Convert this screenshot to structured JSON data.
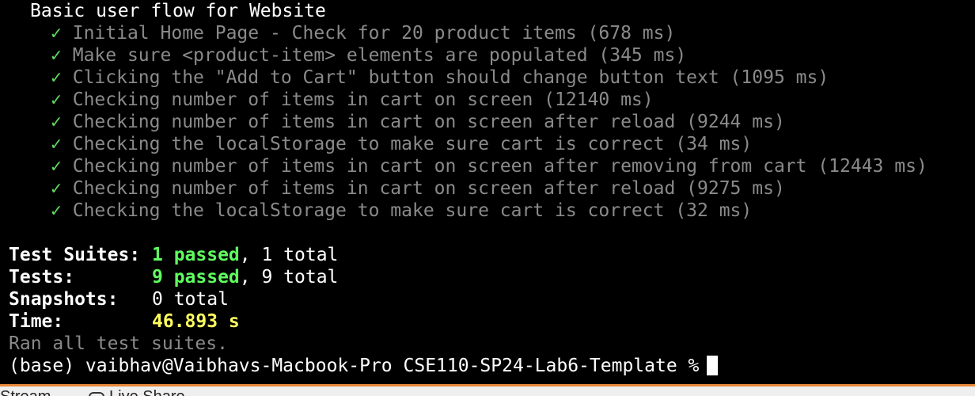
{
  "terminal": {
    "suite_title": "Basic user flow for Website",
    "tests": [
      {
        "check": "✓",
        "text": "Initial Home Page - Check for 20 product items (678 ms)"
      },
      {
        "check": "✓",
        "text": "Make sure <product-item> elements are populated (345 ms)"
      },
      {
        "check": "✓",
        "text": "Clicking the \"Add to Cart\" button should change button text (1095 ms)"
      },
      {
        "check": "✓",
        "text": "Checking number of items in cart on screen (12140 ms)"
      },
      {
        "check": "✓",
        "text": "Checking number of items in cart on screen after reload (9244 ms)"
      },
      {
        "check": "✓",
        "text": "Checking the localStorage to make sure cart is correct (34 ms)"
      },
      {
        "check": "✓",
        "text": "Checking number of items in cart on screen after removing from cart (12443 ms)"
      },
      {
        "check": "✓",
        "text": "Checking number of items in cart on screen after reload (9275 ms)"
      },
      {
        "check": "✓",
        "text": "Checking the localStorage to make sure cart is correct (32 ms)"
      }
    ],
    "summary": {
      "suites_label": "Test Suites:",
      "suites_passed": "1 passed",
      "suites_rest": ", 1 total",
      "tests_label": "Tests:",
      "tests_passed": "9 passed",
      "tests_rest": ", 9 total",
      "snapshots_label": "Snapshots:",
      "snapshots_value": "0 total",
      "time_label": "Time:",
      "time_value": "46.893 s"
    },
    "ran_all": "Ran all test suites.",
    "prompt": "(base) vaibhav@Vaibhavs-Macbook-Pro CSE110-SP24-Lab6-Template %"
  },
  "statusbar": {
    "stream_label": "Stream",
    "live_share_label": "Live Share",
    "live_share_icon": "live-share-icon"
  },
  "colors": {
    "background": "#000000",
    "pass_green": "#5fff5f",
    "check_green": "#5fd75f",
    "muted_gray": "#8a8a8a",
    "time_yellow": "#ffff5f",
    "accent_orange": "#e8893a"
  }
}
